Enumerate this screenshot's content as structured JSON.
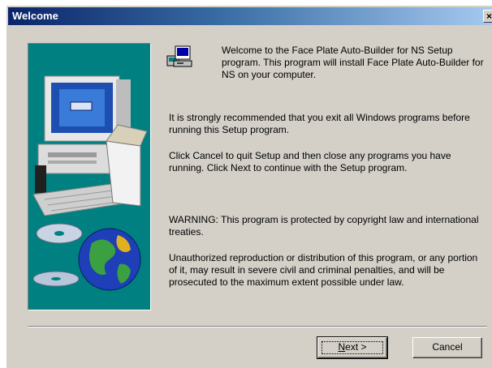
{
  "window": {
    "title": "Welcome",
    "close_glyph": "×"
  },
  "content": {
    "welcome": "Welcome to the Face Plate Auto-Builder for NS Setup program.  This program will install Face Plate Auto-Builder for NS on your computer.",
    "recommend": "It is strongly recommended that you exit all Windows programs before running this Setup program.",
    "cancel_info": "Click Cancel to quit Setup and then close any programs you have running.  Click Next to continue with the Setup program.",
    "warning": "WARNING: This program is protected by copyright law and international treaties.",
    "unauthorized": "Unauthorized reproduction or distribution of this program, or any portion of it, may result in severe civil and criminal penalties, and will be prosecuted to the maximum extent possible under law."
  },
  "buttons": {
    "next_first": "N",
    "next_rest": "ext >",
    "cancel": "Cancel"
  },
  "icons": {
    "side_art": "computer-globe-cd-illustration",
    "setup": "setup-computer-icon",
    "close": "close-icon"
  },
  "colors": {
    "titlebar_start": "#0a246a",
    "titlebar_end": "#a6caf0",
    "panel_bg": "#008080",
    "dialog_bg": "#d4d0c8"
  }
}
